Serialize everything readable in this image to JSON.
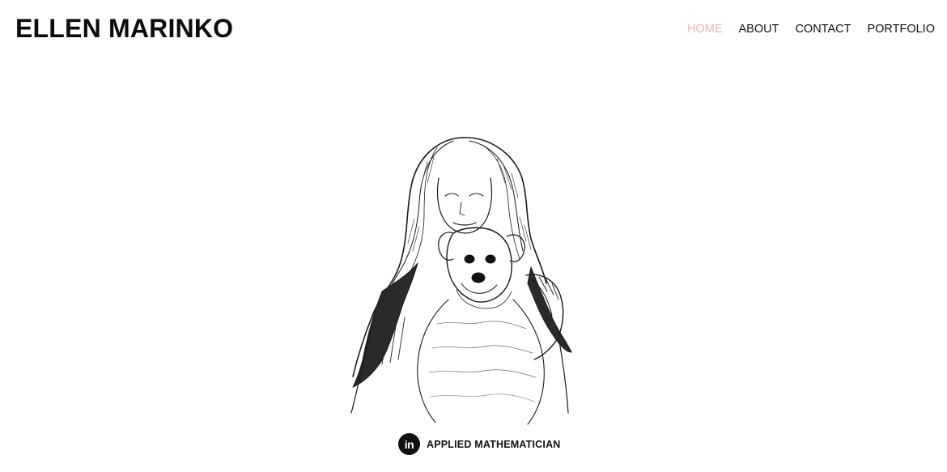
{
  "header": {
    "site_title": "ELLEN MARINKO"
  },
  "nav": {
    "items": [
      {
        "label": "HOME",
        "active": true
      },
      {
        "label": "ABOUT",
        "active": false
      },
      {
        "label": "CONTACT",
        "active": false
      },
      {
        "label": "PORTFOLIO",
        "active": false
      }
    ],
    "active_color": "#f3b4b4",
    "text_color": "#111111"
  },
  "hero": {
    "image": "pencil-sketch-portrait-woman-holding-dog"
  },
  "footer": {
    "linkedin_icon_text": "in",
    "linkedin_icon": "linkedin-icon",
    "tagline": "APPLIED MATHEMATICIAN"
  }
}
